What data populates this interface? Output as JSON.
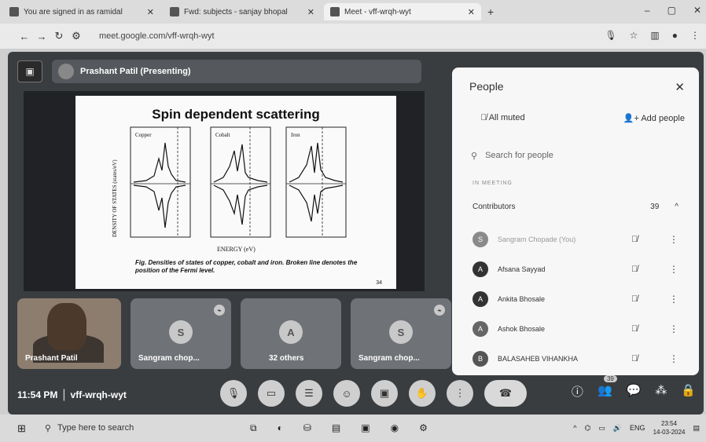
{
  "browser": {
    "tabs": [
      {
        "label": "You are signed in as ramidal",
        "active": false
      },
      {
        "label": "Fwd: subjects - sanjay bhopal",
        "active": false
      },
      {
        "label": "Meet - vff-wrqh-wyt",
        "active": true
      }
    ],
    "url": "meet.google.com/vff-wrqh-wyt"
  },
  "meeting": {
    "presenter_label": "Prashant Patil (Presenting)",
    "slide": {
      "title": "Spin dependent scattering",
      "y_axis_label": "DENSITY OF STATES (states/eV)",
      "x_axis_label": "ENERGY (eV)",
      "panel_labels": [
        "Copper",
        "Cobalt",
        "Iron"
      ],
      "caption": "Fig. Densities of states of copper, cobalt and iron. Broken line denotes the position of the Fermi level.",
      "page_number": "34"
    },
    "tiles": [
      {
        "name": "Prashant Patil",
        "avatar": ""
      },
      {
        "name": "Sangram chop...",
        "avatar": "S"
      },
      {
        "name": "32 others",
        "avatar": "A"
      },
      {
        "name": "Sangram chop...",
        "avatar": "S"
      }
    ],
    "time": "11:54 PM",
    "meeting_code": "vff-wrqh-wyt",
    "participant_badge": "39"
  },
  "people_panel": {
    "title": "People",
    "all_muted": "All muted",
    "add_people": "Add people",
    "search_placeholder": "Search for people",
    "in_meeting": "IN MEETING",
    "contributors_label": "Contributors",
    "contributors_count": "39",
    "participants": [
      {
        "initial": "S",
        "name": "Sangram Chopade (You)"
      },
      {
        "initial": "A",
        "name": "Afsana Sayyad"
      },
      {
        "initial": "A",
        "name": "Ankita Bhosale"
      },
      {
        "initial": "A",
        "name": "Ashok Bhosale"
      },
      {
        "initial": "B",
        "name": "BALASAHEB VIHANKHA"
      }
    ]
  },
  "taskbar": {
    "search_placeholder": "Type here to search",
    "lang": "ENG",
    "time": "23:54",
    "date": "14-03-2024"
  }
}
